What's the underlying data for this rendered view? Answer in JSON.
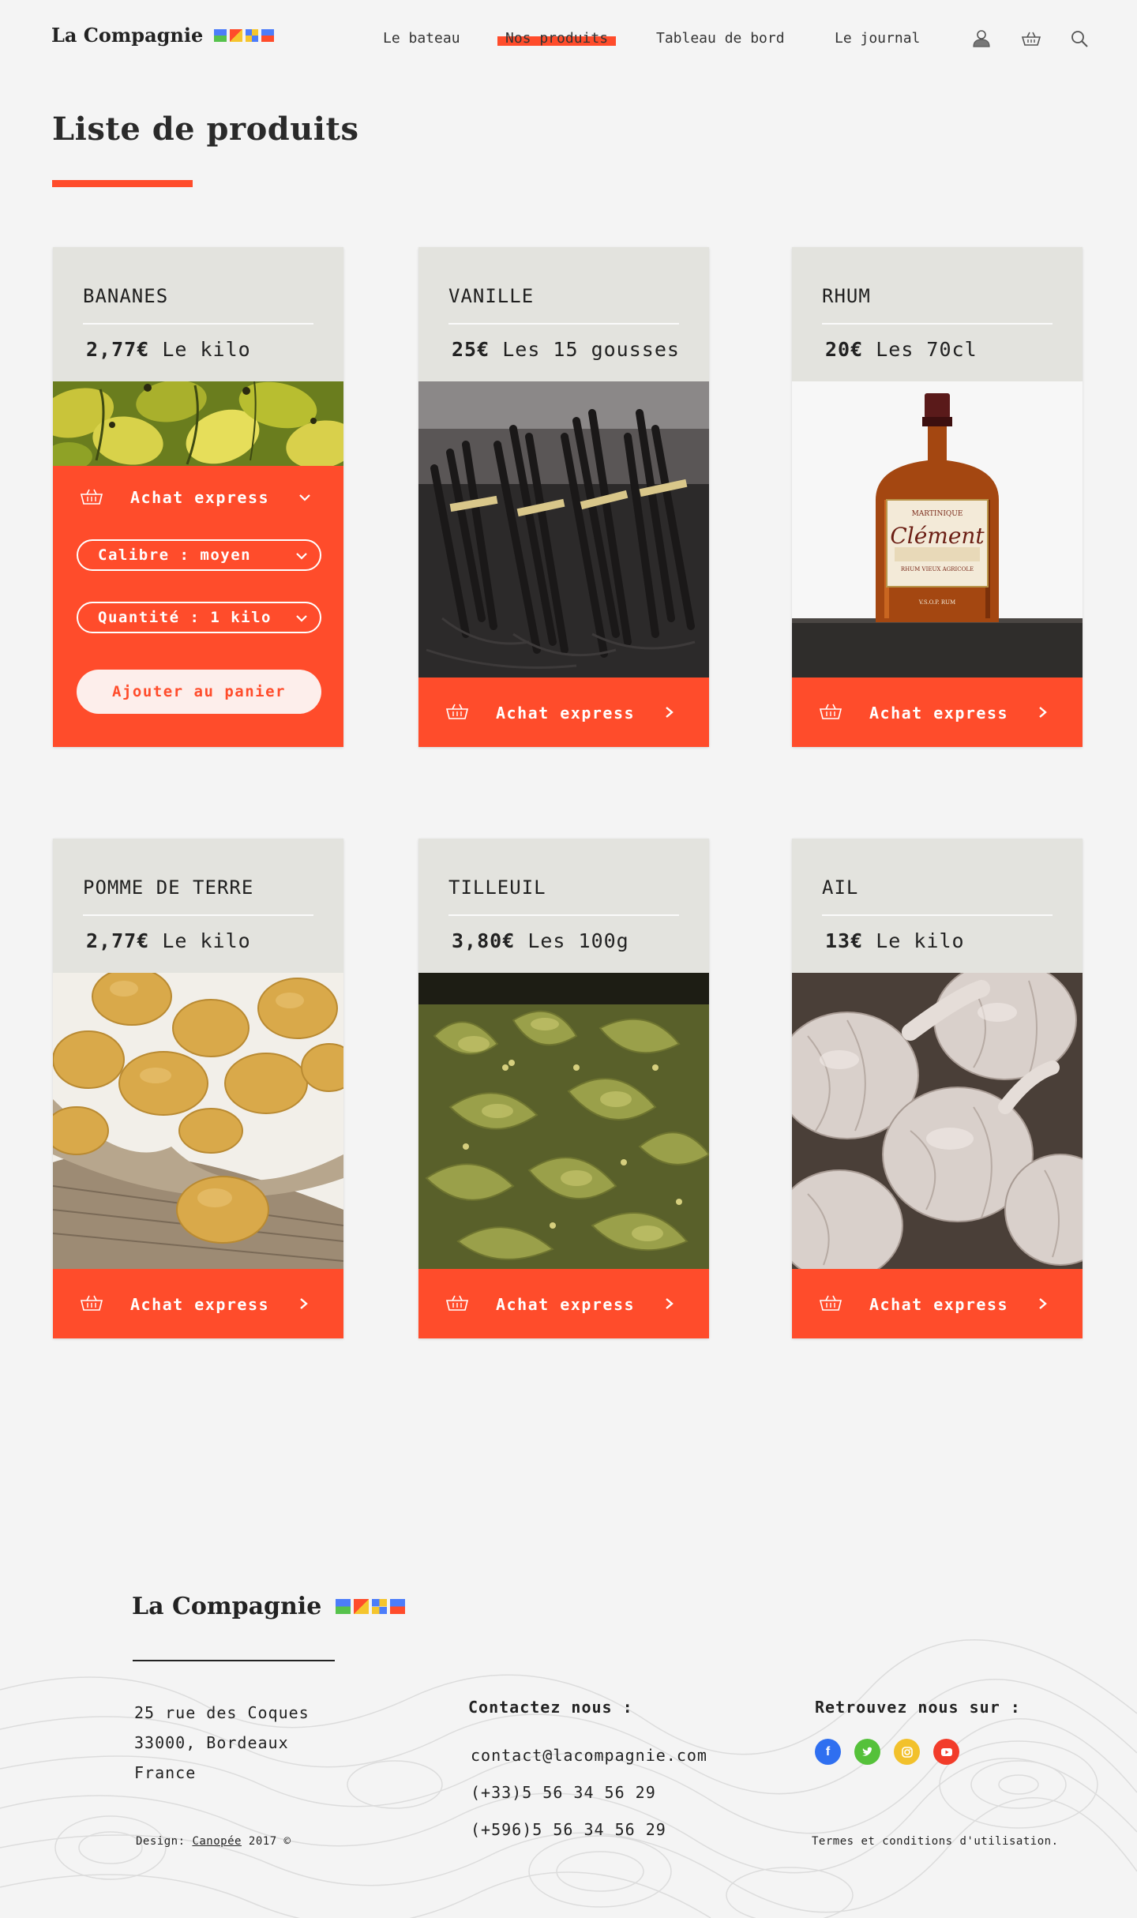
{
  "brand": {
    "name": "La Compagnie"
  },
  "nav": {
    "items": [
      "Le bateau",
      "Nos produits",
      "Tableau de bord",
      "Le journal"
    ],
    "active": "Nos produits"
  },
  "page": {
    "title": "Liste de produits"
  },
  "colors": {
    "accent": "#ff4c2b",
    "card_head": "#e3e3de",
    "background": "#f4f4f4"
  },
  "products": [
    {
      "name": "BANANES",
      "price": "2,77€",
      "unit": "Le kilo",
      "image": "bananas",
      "expanded": true
    },
    {
      "name": "VANILLE",
      "price": "25€",
      "unit": "Les 15 gousses",
      "image": "vanilla-pods"
    },
    {
      "name": "RHUM",
      "price": "20€",
      "unit": "Les 70cl",
      "image": "rum-bottle"
    },
    {
      "name": "POMME DE TERRE",
      "price": "2,77€",
      "unit": "Le kilo",
      "image": "potatoes"
    },
    {
      "name": "TILLEUIL",
      "price": "3,80€",
      "unit": "Les 100g",
      "image": "linden-leaves"
    },
    {
      "name": "AIL",
      "price": "13€",
      "unit": "Le kilo",
      "image": "garlic"
    }
  ],
  "express": {
    "label": "Achat express",
    "calibre": "Calibre : moyen",
    "quantite": "Quantité : 1 kilo",
    "add_to_cart": "Ajouter au panier"
  },
  "rum_label": {
    "top": "MARTINIQUE",
    "brand": "Clément",
    "sub": "RHUM VIEUX AGRICOLE",
    "grade": "V.S.O.P. RUM"
  },
  "footer": {
    "address": [
      "25 rue des Coques",
      "33000, Bordeaux",
      "France"
    ],
    "contact_title": "Contactez nous :",
    "contact": [
      "contact@lacompagnie.com",
      "(+33)5 56 34 56 29",
      "(+596)5 56 34 56 29"
    ],
    "social_title": "Retrouvez nous sur :",
    "socials": [
      "facebook",
      "twitter",
      "instagram",
      "youtube"
    ],
    "design_prefix": "Design:",
    "design_link": "Canopée",
    "design_suffix": "2017 ©",
    "terms": "Termes et conditions d'utilisation."
  }
}
